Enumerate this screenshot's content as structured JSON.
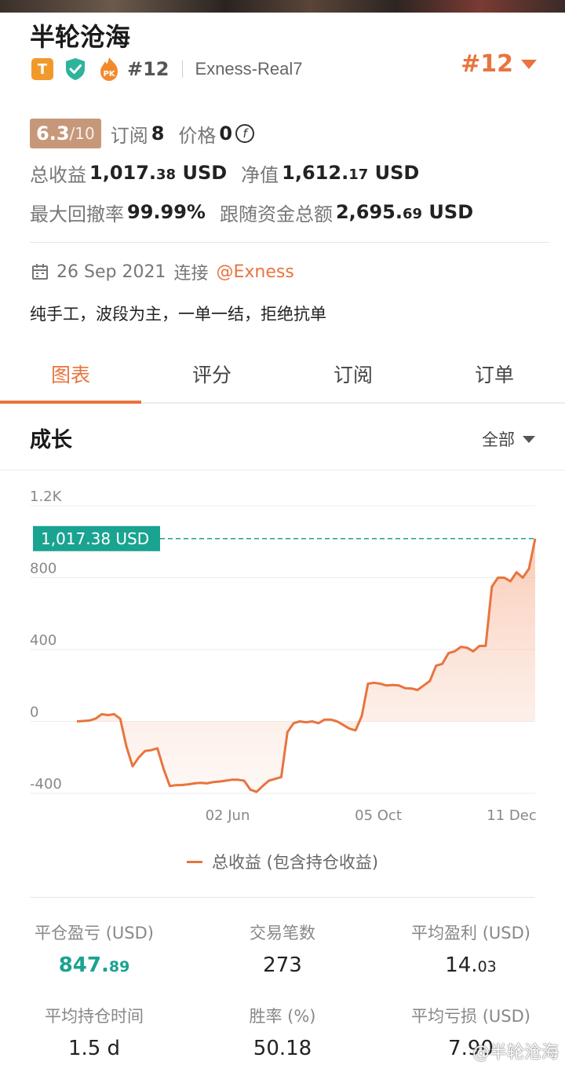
{
  "header": {
    "name": "半轮沧海",
    "badge_t": "T",
    "rank_small": "#12",
    "account": "Exness-Real7",
    "rank_big": "#12"
  },
  "stats": {
    "score_main": "6.3",
    "score_total": "/10",
    "subscribe_label": "订阅",
    "subscribe_value": "8",
    "price_label": "价格",
    "price_value": "0",
    "coin_symbol": "f",
    "total_profit_label": "总收益",
    "total_profit_int": "1,017.",
    "total_profit_dec": "38",
    "total_profit_unit": "USD",
    "equity_label": "净值",
    "equity_int": "1,612.",
    "equity_dec": "17",
    "equity_unit": "USD",
    "drawdown_label": "最大回撤率",
    "drawdown_value": "99.99%",
    "follow_label": "跟随资金总额",
    "follow_int": "2,695.",
    "follow_dec": "69",
    "follow_unit": "USD"
  },
  "info": {
    "date": "26 Sep 2021",
    "connect_label": "连接",
    "broker": "@Exness",
    "description": "纯手工，波段为主，一单一结，拒绝抗单"
  },
  "tabs": [
    {
      "label": "图表",
      "active": true
    },
    {
      "label": "评分",
      "active": false
    },
    {
      "label": "订阅",
      "active": false
    },
    {
      "label": "订单",
      "active": false
    }
  ],
  "growth": {
    "title": "成长",
    "range": "全部"
  },
  "chart_data": {
    "type": "area",
    "title": "",
    "current_label": "1,017.38 USD",
    "current_value": 1017.38,
    "ylim": [
      -400,
      1200
    ],
    "yticks": [
      {
        "v": 1200,
        "label": "1.2K"
      },
      {
        "v": 800,
        "label": "800"
      },
      {
        "v": 400,
        "label": "400"
      },
      {
        "v": 0,
        "label": "0"
      },
      {
        "v": -400,
        "label": "-400"
      }
    ],
    "xticks": [
      "02 Jun",
      "05 Oct",
      "11 Dec"
    ],
    "colors": {
      "line": "#e8743f",
      "current": "#1aa391"
    },
    "series": [
      {
        "name": "总收益 (包含持仓收益)",
        "values": [
          0,
          2,
          5,
          15,
          40,
          35,
          40,
          15,
          -140,
          -250,
          -200,
          -165,
          -160,
          -150,
          -265,
          -360,
          -355,
          -354,
          -350,
          -345,
          -342,
          -345,
          -338,
          -335,
          -330,
          -325,
          -325,
          -330,
          -380,
          -392,
          -360,
          -330,
          -320,
          -310,
          -60,
          -10,
          0,
          -5,
          0,
          -10,
          10,
          10,
          0,
          -20,
          -40,
          -50,
          30,
          210,
          215,
          210,
          200,
          203,
          200,
          185,
          183,
          175,
          200,
          225,
          310,
          320,
          380,
          390,
          415,
          410,
          390,
          420,
          420,
          750,
          800,
          800,
          780,
          830,
          800,
          850,
          1017.38
        ]
      }
    ]
  },
  "legend": {
    "label": "总收益 (包含持仓收益)"
  },
  "metrics": [
    {
      "label": "平仓盈亏 (USD)",
      "int": "847.",
      "dec": "89",
      "green": true
    },
    {
      "label": "交易笔数",
      "int": "273",
      "dec": "",
      "green": false
    },
    {
      "label": "平均盈利 (USD)",
      "int": "14.",
      "dec": "03",
      "green": false
    },
    {
      "label": "平均持仓时间",
      "int": "1.5 d",
      "dec": "",
      "green": false
    },
    {
      "label": "胜率 (%)",
      "int": "50.18",
      "dec": "",
      "green": false
    },
    {
      "label": "平均亏损 (USD)",
      "int": "7.90",
      "dec": "",
      "green": false
    }
  ],
  "watermark": "@半轮沧海"
}
